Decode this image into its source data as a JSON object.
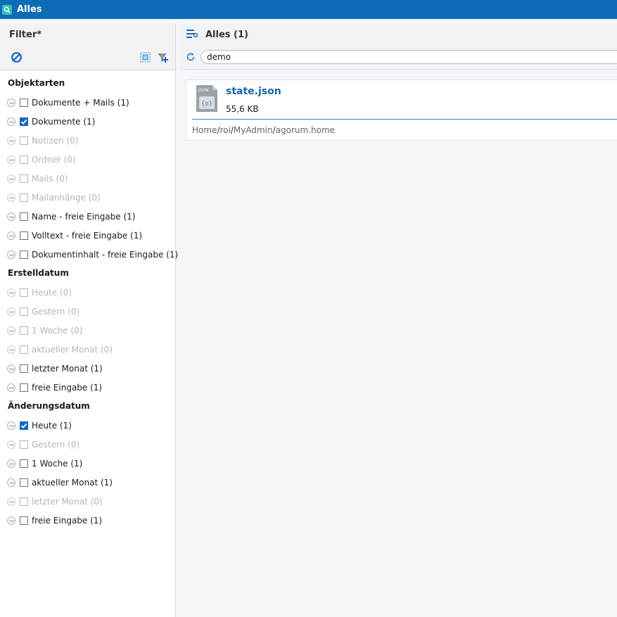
{
  "window": {
    "title": "Alles",
    "app_icon": "search-icon"
  },
  "filter_panel": {
    "title": "Filter*",
    "clear_icon": "clear-filter-icon",
    "select_icon": "select-area-icon",
    "funnel_icon": "add-filter-icon",
    "sections": [
      {
        "title": "Objektarten",
        "items": [
          {
            "label": "Dokumente + Mails (1)",
            "checked": false,
            "disabled": false
          },
          {
            "label": "Dokumente (1)",
            "checked": true,
            "disabled": false
          },
          {
            "label": "Notizen (0)",
            "checked": false,
            "disabled": true
          },
          {
            "label": "Ordner (0)",
            "checked": false,
            "disabled": true
          },
          {
            "label": "Mails (0)",
            "checked": false,
            "disabled": true
          },
          {
            "label": "Mailanhänge (0)",
            "checked": false,
            "disabled": true
          },
          {
            "label": "Name - freie Eingabe (1)",
            "checked": false,
            "disabled": false
          },
          {
            "label": "Volltext - freie Eingabe (1)",
            "checked": false,
            "disabled": false
          },
          {
            "label": "Dokumentinhalt - freie Eingabe (1)",
            "checked": false,
            "disabled": false
          }
        ]
      },
      {
        "title": "Erstelldatum",
        "items": [
          {
            "label": "Heute (0)",
            "checked": false,
            "disabled": true
          },
          {
            "label": "Gestern (0)",
            "checked": false,
            "disabled": true
          },
          {
            "label": "1 Woche (0)",
            "checked": false,
            "disabled": true
          },
          {
            "label": "aktueller Monat (0)",
            "checked": false,
            "disabled": true
          },
          {
            "label": "letzter Monat (1)",
            "checked": false,
            "disabled": false
          },
          {
            "label": "freie Eingabe (1)",
            "checked": false,
            "disabled": false
          }
        ]
      },
      {
        "title": "Änderungsdatum",
        "items": [
          {
            "label": "Heute (1)",
            "checked": true,
            "disabled": false
          },
          {
            "label": "Gestern (0)",
            "checked": false,
            "disabled": true
          },
          {
            "label": "1 Woche (1)",
            "checked": false,
            "disabled": false
          },
          {
            "label": "aktueller Monat (1)",
            "checked": false,
            "disabled": false
          },
          {
            "label": "letzter Monat (0)",
            "checked": false,
            "disabled": true
          },
          {
            "label": "freie Eingabe (1)",
            "checked": false,
            "disabled": false
          }
        ]
      }
    ]
  },
  "results": {
    "title": "Alles (1)",
    "header_icon": "list-settings-icon",
    "refresh_icon": "refresh-icon",
    "search": {
      "value": "demo"
    },
    "items": [
      {
        "file_icon": "json-file-icon",
        "icon_label": "JSON",
        "name": "state.json",
        "size": "55,6 KB",
        "path": [
          "Home",
          "roi",
          "MyAdmin",
          "agorum.home"
        ],
        "path_separator": "/"
      }
    ]
  },
  "colors": {
    "titlebar": "#0f6bb6",
    "checkbox_checked": "#1565c0",
    "file_name": "#1565a8",
    "divider": "#1f8dbf",
    "disabled_text": "#b1b5ba"
  }
}
